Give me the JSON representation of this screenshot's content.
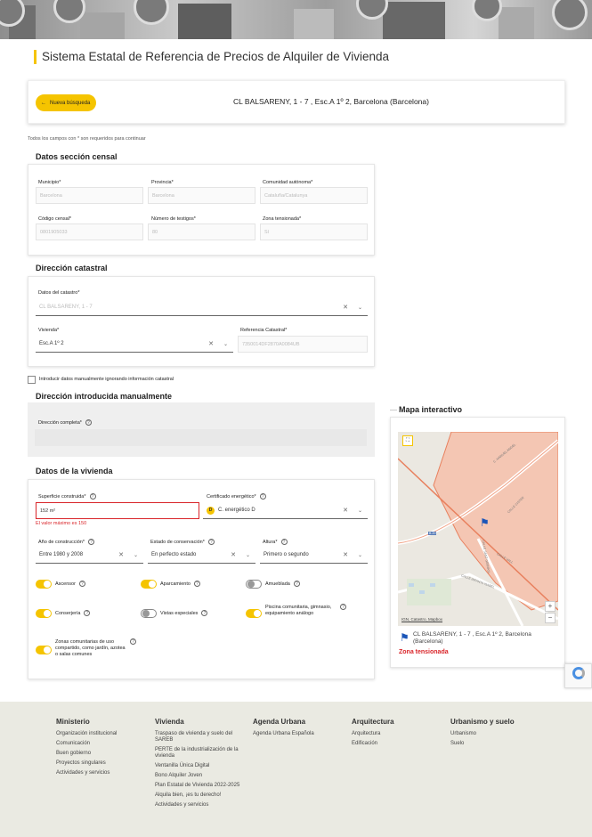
{
  "header": {
    "title": "Sistema Estatal de Referencia de Precios de Alquiler de Vivienda"
  },
  "search": {
    "new_search": "Nueva búsqueda",
    "address": "CL BALSARENY, 1 - 7 , Esc.A 1º 2, Barcelona (Barcelona)"
  },
  "required_note": "Todos los campos con * son requeridos para continuar",
  "census": {
    "title": "Datos sección censal",
    "municipio_label": "Municipio*",
    "municipio_value": "Barcelona",
    "provincia_label": "Provincia*",
    "provincia_value": "Barcelona",
    "comunidad_label": "Comunidad autónoma*",
    "comunidad_value": "Cataluña/Catalunya",
    "codigo_label": "Código censal*",
    "codigo_value": "0801905033",
    "testigos_label": "Número de testigos*",
    "testigos_value": "80",
    "zona_label": "Zona tensionada*",
    "zona_value": "Sí"
  },
  "catastral": {
    "title": "Dirección catastral",
    "datos_label": "Datos del catastro*",
    "datos_value": "CL BALSARENY, 1 - 7",
    "vivienda_label": "Vivienda*",
    "vivienda_value": "Esc.A 1º 2",
    "ref_label": "Referencia Catastral*",
    "ref_value": "7350014DF2870A0084UB"
  },
  "manual_check": "Introducir datos manualmente ignorando información catastral",
  "manual": {
    "title": "Dirección introducida manualmente",
    "label": "Dirección completa*"
  },
  "vivienda": {
    "title": "Datos de la vivienda",
    "superficie_label": "Superficie construida*",
    "superficie_value": "152",
    "superficie_unit": "m²",
    "superficie_error": "El valor máximo es 150",
    "cert_label": "Certificado energético*",
    "cert_badge": "D",
    "cert_value": "C. energético D",
    "anio_label": "Año de construcción*",
    "anio_value": "Entre 1980 y 2008",
    "estado_label": "Estado de conservación*",
    "estado_value": "En perfecto estado",
    "altura_label": "Altura*",
    "altura_value": "Primero o segundo",
    "toggles": {
      "ascensor": "Ascensor",
      "aparcamiento": "Aparcamiento",
      "amueblada": "Amueblada",
      "conserjeria": "Conserjería",
      "vistas": "Vistas especiales",
      "piscina": "Piscina comunitaria, gimnasio, equipamiento análogo",
      "zonas": "Zonas comunitarias de uso compartido, como jardín, azotea o salas comunes"
    }
  },
  "map": {
    "title": "Mapa interactivo",
    "addr": "CL BALSARENY, 1 - 7 , Esc.A 1º 2, Barcelona (Barcelona)",
    "zona": "Zona tensionada",
    "attribution": "IGN, Catastro, Mapbox",
    "zoom_in": "+",
    "zoom_out": "−",
    "streets": [
      "C. MANUEL ANGEL",
      "CALLE CISTER",
      "CALLE VALL",
      "CALLE INFANTA ISABEL",
      "B-20",
      "CALLE SANT GERVASI"
    ]
  },
  "footer": {
    "ministerio": {
      "h": "Ministerio",
      "items": [
        "Organización institucional",
        "Comunicación",
        "Buen gobierno",
        "Proyectos singulares",
        "Actividades y servicios"
      ]
    },
    "vivienda": {
      "h": "Vivienda",
      "items": [
        "Traspaso de vivienda y suelo del SAREB",
        "PERTE de la industrialización de la vivienda",
        "Ventanilla Única Digital",
        "Bono Alquiler Joven",
        "Plan Estatal de Vivienda 2022-2025",
        "Alquila bien, ¡es tu derecho!",
        "Actividades y servicios"
      ]
    },
    "agenda": {
      "h": "Agenda Urbana",
      "items": [
        "Agenda Urbana Española"
      ]
    },
    "arquitectura": {
      "h": "Arquitectura",
      "items": [
        "Arquitectura",
        "Edificación"
      ]
    },
    "urbanismo": {
      "h": "Urbanismo y suelo",
      "items": [
        "Urbanismo",
        "Suelo"
      ]
    }
  },
  "colors": {
    "accent": "#f5c400",
    "error": "#d9252a"
  }
}
